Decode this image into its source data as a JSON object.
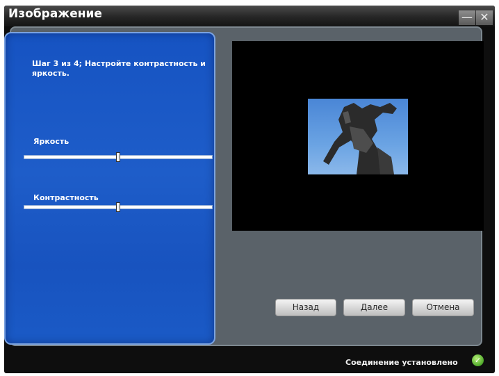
{
  "window": {
    "title": "Изображение",
    "minimize_glyph": "—",
    "close_glyph": "✕"
  },
  "wizard": {
    "step_text": "Шаг 3 из 4; Настройте контрастность и яркость.",
    "brightness": {
      "label": "Яркость",
      "value": 0.5
    },
    "contrast": {
      "label": "Контрастность",
      "value": 0.5
    }
  },
  "preview": {
    "image_icon": "photo-preview"
  },
  "buttons": {
    "back": "Назад",
    "next": "Далее",
    "cancel": "Отмена"
  },
  "status": {
    "text": "Соединение установлено",
    "icon": "check-icon",
    "icon_glyph": "✓",
    "color": "#4fa92a"
  },
  "colors": {
    "panel_blue": "#1a5ac6",
    "content_gray": "#5a6269",
    "window_dark": "#0e0e0e"
  }
}
